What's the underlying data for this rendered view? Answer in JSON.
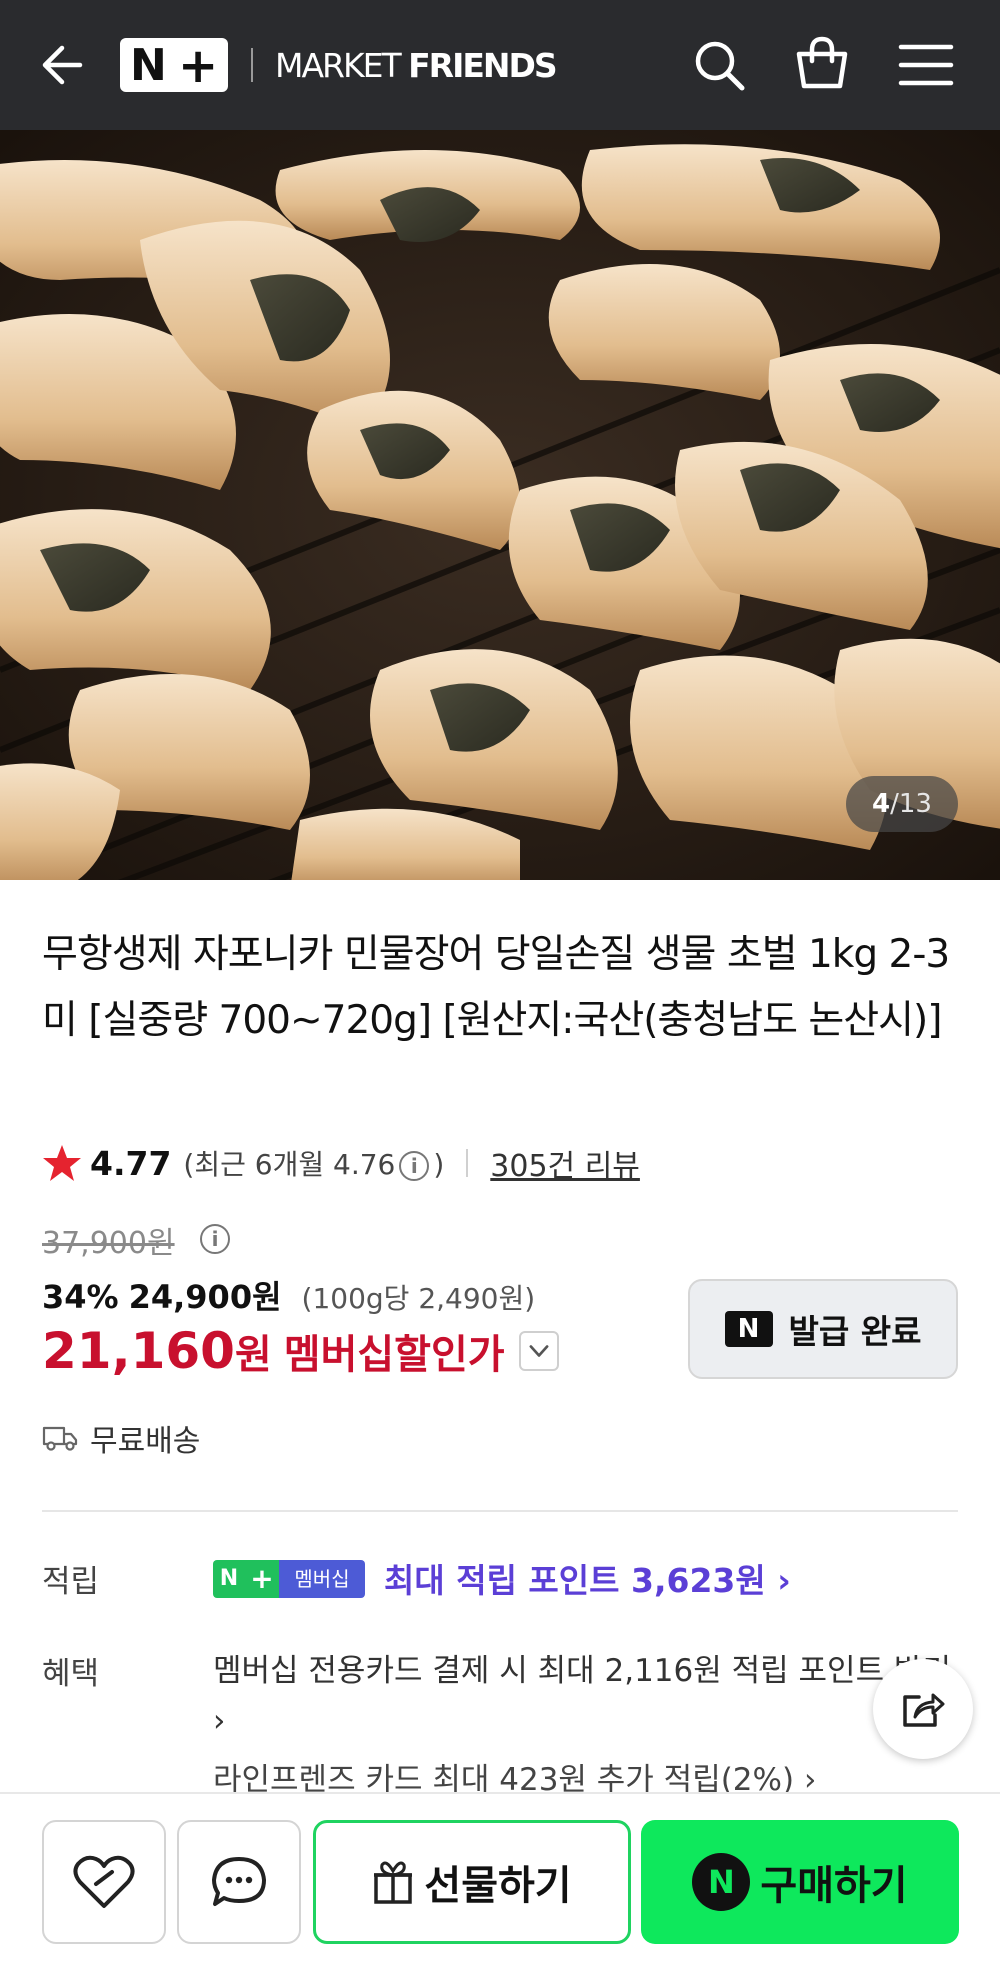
{
  "header": {
    "logo_n": "N",
    "logo_plus": "+",
    "brand_light": "MARKET ",
    "brand_bold": "FRIENDS",
    "bg_color": "#2a2b2e"
  },
  "gallery": {
    "current": "4",
    "separator": "/",
    "total": "13"
  },
  "product": {
    "title": "무항생제 자포니카 민물장어 당일손질 생물 초벌 1kg 2-3미 [실중량 700~720g] [원산지:국산(충청남도 논산시)]",
    "rating": "4.77",
    "rating_recent_prefix": "(최근 6개월 4.76",
    "rating_recent_suffix": ")",
    "review_count": "305건 리뷰",
    "original_price": "37,900원",
    "discount_percent": "34%",
    "discount_price": "24,900원",
    "unit_price": "(100g당 2,490원)",
    "member_price_number": "21,160",
    "member_price_won": "원",
    "member_price_label": "멤버십할인가",
    "coupon_label": "발급 완료",
    "coupon_n": "N",
    "shipping": "무료배송",
    "accent_color": "#c8102e"
  },
  "benefits": {
    "points_label": "적립",
    "badge_n": "N",
    "badge_plus": "+",
    "badge_text": "멤버십",
    "points_text": "최대 적립 포인트 3,623원 ›",
    "benefit_label": "혜택",
    "benefit_1": "멤버십 전용카드 결제 시 최대 2,116원 적립 포인트 받기 ›",
    "benefit_2": "라인프렌즈 카드 최대 423원 추가 적립(2%) ›"
  },
  "bottom_bar": {
    "gift_label": "선물하기",
    "buy_n": "N",
    "buy_label": "구매하기",
    "buy_color": "#0ee85c"
  },
  "icons": [
    "back-arrow-icon",
    "search-icon",
    "shopping-bag-icon",
    "menu-icon",
    "star-icon",
    "info-icon",
    "chevron-down-icon",
    "truck-icon",
    "share-icon",
    "heart-icon",
    "chat-icon",
    "gift-icon"
  ]
}
